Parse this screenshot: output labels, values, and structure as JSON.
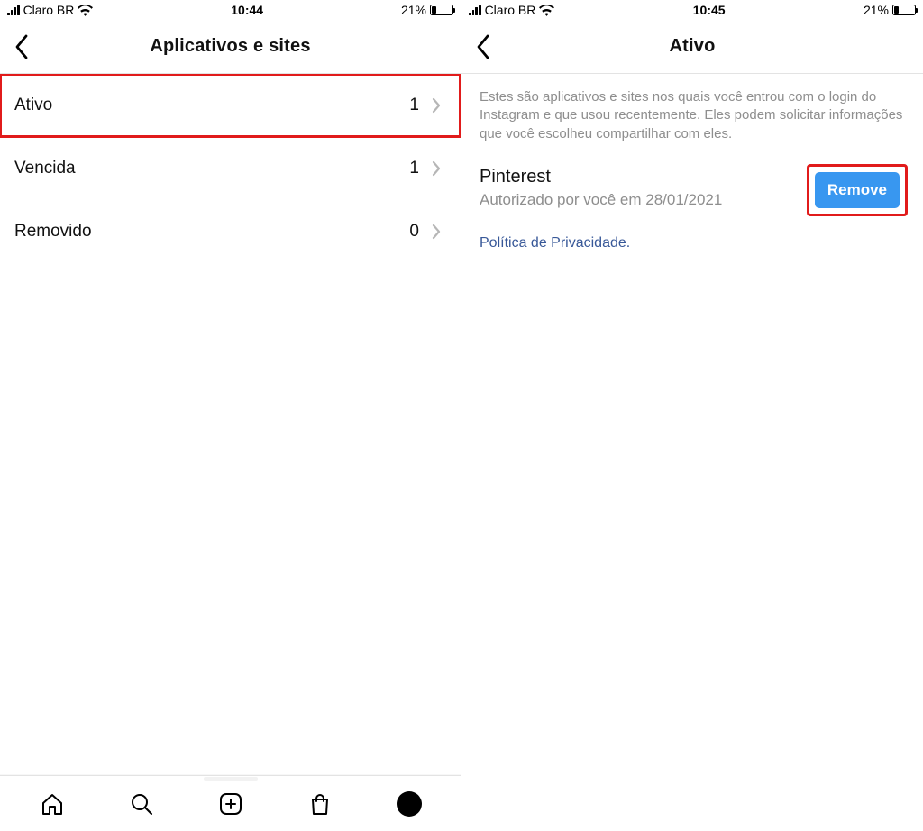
{
  "left": {
    "status": {
      "carrier": "Claro BR",
      "time": "10:44",
      "battery_pct": "21%"
    },
    "header": {
      "title": "Aplicativos e sites"
    },
    "rows": [
      {
        "label": "Ativo",
        "count": "1"
      },
      {
        "label": "Vencida",
        "count": "1"
      },
      {
        "label": "Removido",
        "count": "0"
      }
    ]
  },
  "right": {
    "status": {
      "carrier": "Claro BR",
      "time": "10:45",
      "battery_pct": "21%"
    },
    "header": {
      "title": "Ativo"
    },
    "description": "Estes são aplicativos e sites nos quais você entrou com o login do Instagram e que usou recentemente. Eles podem solicitar informações que você escolheu compartilhar com eles.",
    "app": {
      "name": "Pinterest",
      "authorized": "Autorizado por você em 28/01/2021",
      "remove_label": "Remove"
    },
    "privacy_link": "Política de Privacidade."
  }
}
